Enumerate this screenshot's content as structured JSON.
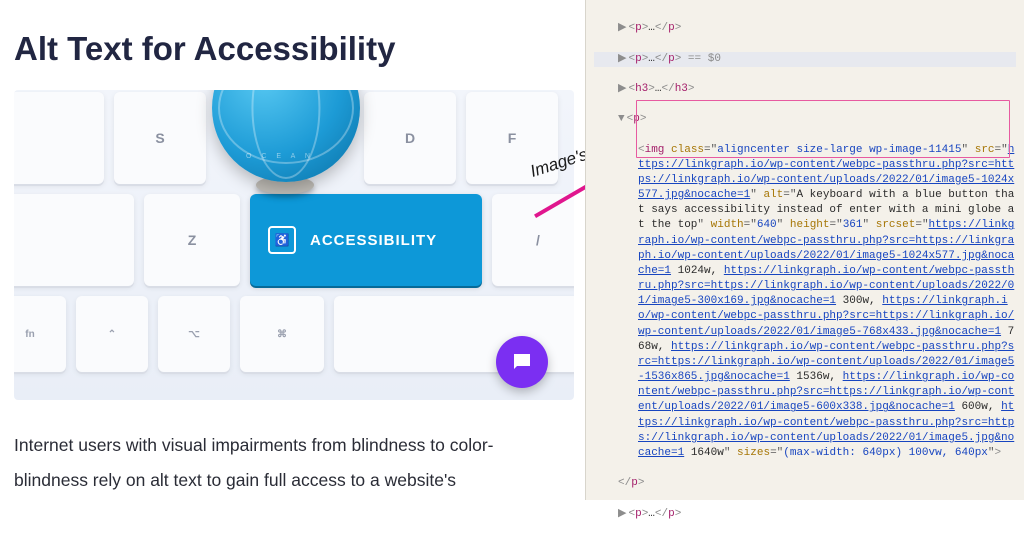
{
  "left": {
    "heading": "Alt Text for Accessibility",
    "acc_key_label": "ACCESSIBILITY",
    "globe_label": "O C E A N",
    "keycaps": {
      "s": "S",
      "d": "D",
      "f": "F",
      "z": "Z",
      "slash": "/",
      "fn": "fn",
      "ctrl": "⌃",
      "opt": "⌥",
      "cmd": "⌘"
    },
    "body1": "Internet users with visual impairments from blindness to color-",
    "body2": "blindness rely on alt text to gain full access to a website's"
  },
  "annotation": {
    "label": "Image's Alt Text"
  },
  "code": {
    "l1": "…",
    "l1_tag": "p",
    "l2_pre": "…",
    "l2_tag": "p",
    "l2_post": " == $0",
    "l3_tag": "h3",
    "l3_mid": "…",
    "l4_tag": "p",
    "img_tag": "img",
    "class_attr": "class",
    "class_val": "aligncenter size-large wp-image-11415",
    "src_attr": "src",
    "src_val": "https://linkgraph.io/wp-content/webpc-passthru.php?src=https://linkgraph.io/wp-content/uploads/2022/01/image5-1024x577.jpg&nocache=1",
    "alt_attr": "alt",
    "alt_val": "A keyboard with a blue button that says accessibility instead of enter with a mini globe at the top",
    "width_attr": "width",
    "width_val": "640",
    "height_attr": "height",
    "height_val": "361",
    "srcset_attr": "srcset",
    "ss1_url": "https://linkgraph.io/wp-content/webpc-passthru.php?src=https://linkgraph.io/wp-content/uploads/2022/01/image5-1024x577.jpg&nocache=1",
    "ss1_w": " 1024w, ",
    "ss2_url": "https://linkgraph.io/wp-content/webpc-passthru.php?src=https://linkgraph.io/wp-content/uploads/2022/01/image5-300x169.jpg&nocache=1",
    "ss2_w": " 300w, ",
    "ss3_url": "https://linkgraph.io/wp-content/webpc-passthru.php?src=https://linkgraph.io/wp-content/uploads/2022/01/image5-768x433.jpg&nocache=1",
    "ss3_w": " 768w, ",
    "ss4_url": "https://linkgraph.io/wp-content/webpc-passthru.php?src=https://linkgraph.io/wp-content/uploads/2022/01/image5-1536x865.jpg&nocache=1",
    "ss4_w": " 1536w, ",
    "ss5_url": "https://linkgraph.io/wp-content/webpc-passthru.php?src=https://linkgraph.io/wp-content/uploads/2022/01/image5-600x338.jpg&nocache=1",
    "ss5_w": " 600w, ",
    "ss6_url": "https://linkgraph.io/wp-content/webpc-passthru.php?src=https://linkgraph.io/wp-content/uploads/2022/01/image5.jpg&nocache=1",
    "ss6_w": " 1640w",
    "sizes_attr": "sizes",
    "sizes_val": "(max-width: 640px) 100vw, 640px",
    "close_p": "p",
    "last_p": "p"
  }
}
